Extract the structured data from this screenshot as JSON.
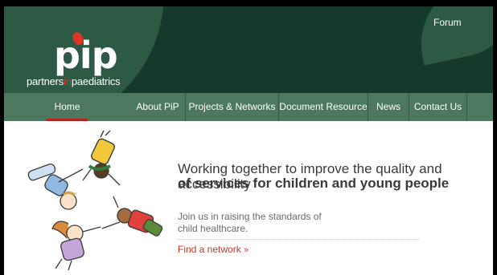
{
  "header": {
    "logo_word": "pip",
    "logo_tag_before": "partners",
    "logo_tag_in": "in",
    "logo_tag_after": "paediatrics",
    "forum_label": "Forum"
  },
  "nav": {
    "items": [
      {
        "label": "Home",
        "active": true
      },
      {
        "label": "About PiP"
      },
      {
        "label": "Projects & Networks"
      },
      {
        "label": "Document Resource"
      },
      {
        "label": "News"
      },
      {
        "label": "Contact Us"
      }
    ]
  },
  "main": {
    "tagline": "Working together to improve the quality and accessibility",
    "tagline_strong": "of services for children and young people",
    "join_text": "Join us in raising the standards of child healthcare.",
    "find_link": "Find a network",
    "find_chevron": "»"
  },
  "colors": {
    "header_bg": "#153a2b",
    "nav_bg": "#4d7860",
    "accent_red": "#c0392b"
  }
}
